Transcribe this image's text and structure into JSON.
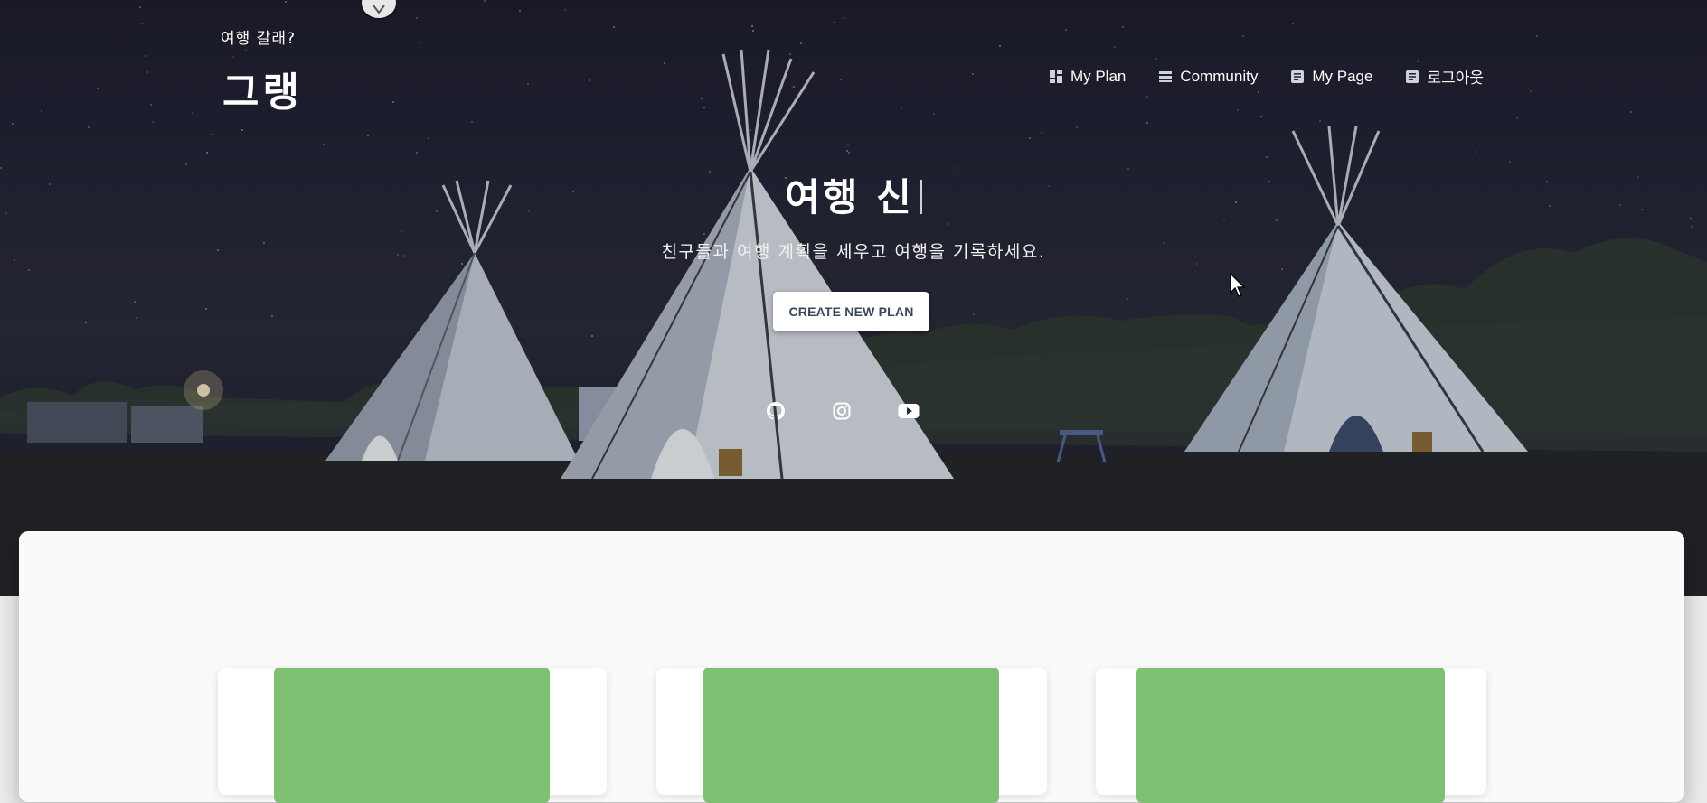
{
  "brand": {
    "tagline": "여행 갈래?",
    "name": "그랭"
  },
  "nav": {
    "items": [
      {
        "label": "My Plan",
        "icon": "dashboard-icon"
      },
      {
        "label": "Community",
        "icon": "list-icon"
      },
      {
        "label": "My Page",
        "icon": "article-icon"
      },
      {
        "label": "로그아웃",
        "icon": "article-icon"
      }
    ]
  },
  "hero": {
    "title": "여행 신",
    "subtitle": "친구들과 여행 계획을 세우고 여행을 기록하세요.",
    "cta_label": "CREATE NEW PLAN"
  },
  "socials": [
    {
      "icon": "github-icon"
    },
    {
      "icon": "instagram-icon"
    },
    {
      "icon": "youtube-icon"
    }
  ],
  "colors": {
    "card_image": "#7ec173",
    "cta_text": "#3c4858"
  }
}
